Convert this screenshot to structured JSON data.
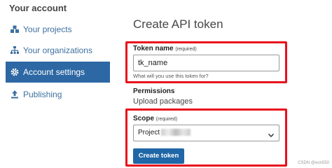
{
  "sidebar": {
    "heading": "Your account",
    "items": [
      {
        "label": "Your projects",
        "icon": "cubes-icon",
        "active": false
      },
      {
        "label": "Your organizations",
        "icon": "sitemap-icon",
        "active": false
      },
      {
        "label": "Account settings",
        "icon": "gear-icon",
        "active": true
      },
      {
        "label": "Publishing",
        "icon": "upload-icon",
        "active": false
      }
    ]
  },
  "main": {
    "title": "Create API token",
    "token_name": {
      "label": "Token name",
      "required_text": "(required)",
      "value": "tk_name",
      "help": "What will you use this token for?"
    },
    "permissions": {
      "heading": "Permissions",
      "value": "Upload packages"
    },
    "scope": {
      "label": "Scope",
      "required_text": "(required)",
      "selected": "Project"
    },
    "create_button": "Create token"
  },
  "watermark": "CSDN @eon550",
  "colors": {
    "accent": "#2d68a4",
    "link": "#3d70a0",
    "highlight_border": "#e8101c",
    "button": "#1f67a6"
  }
}
